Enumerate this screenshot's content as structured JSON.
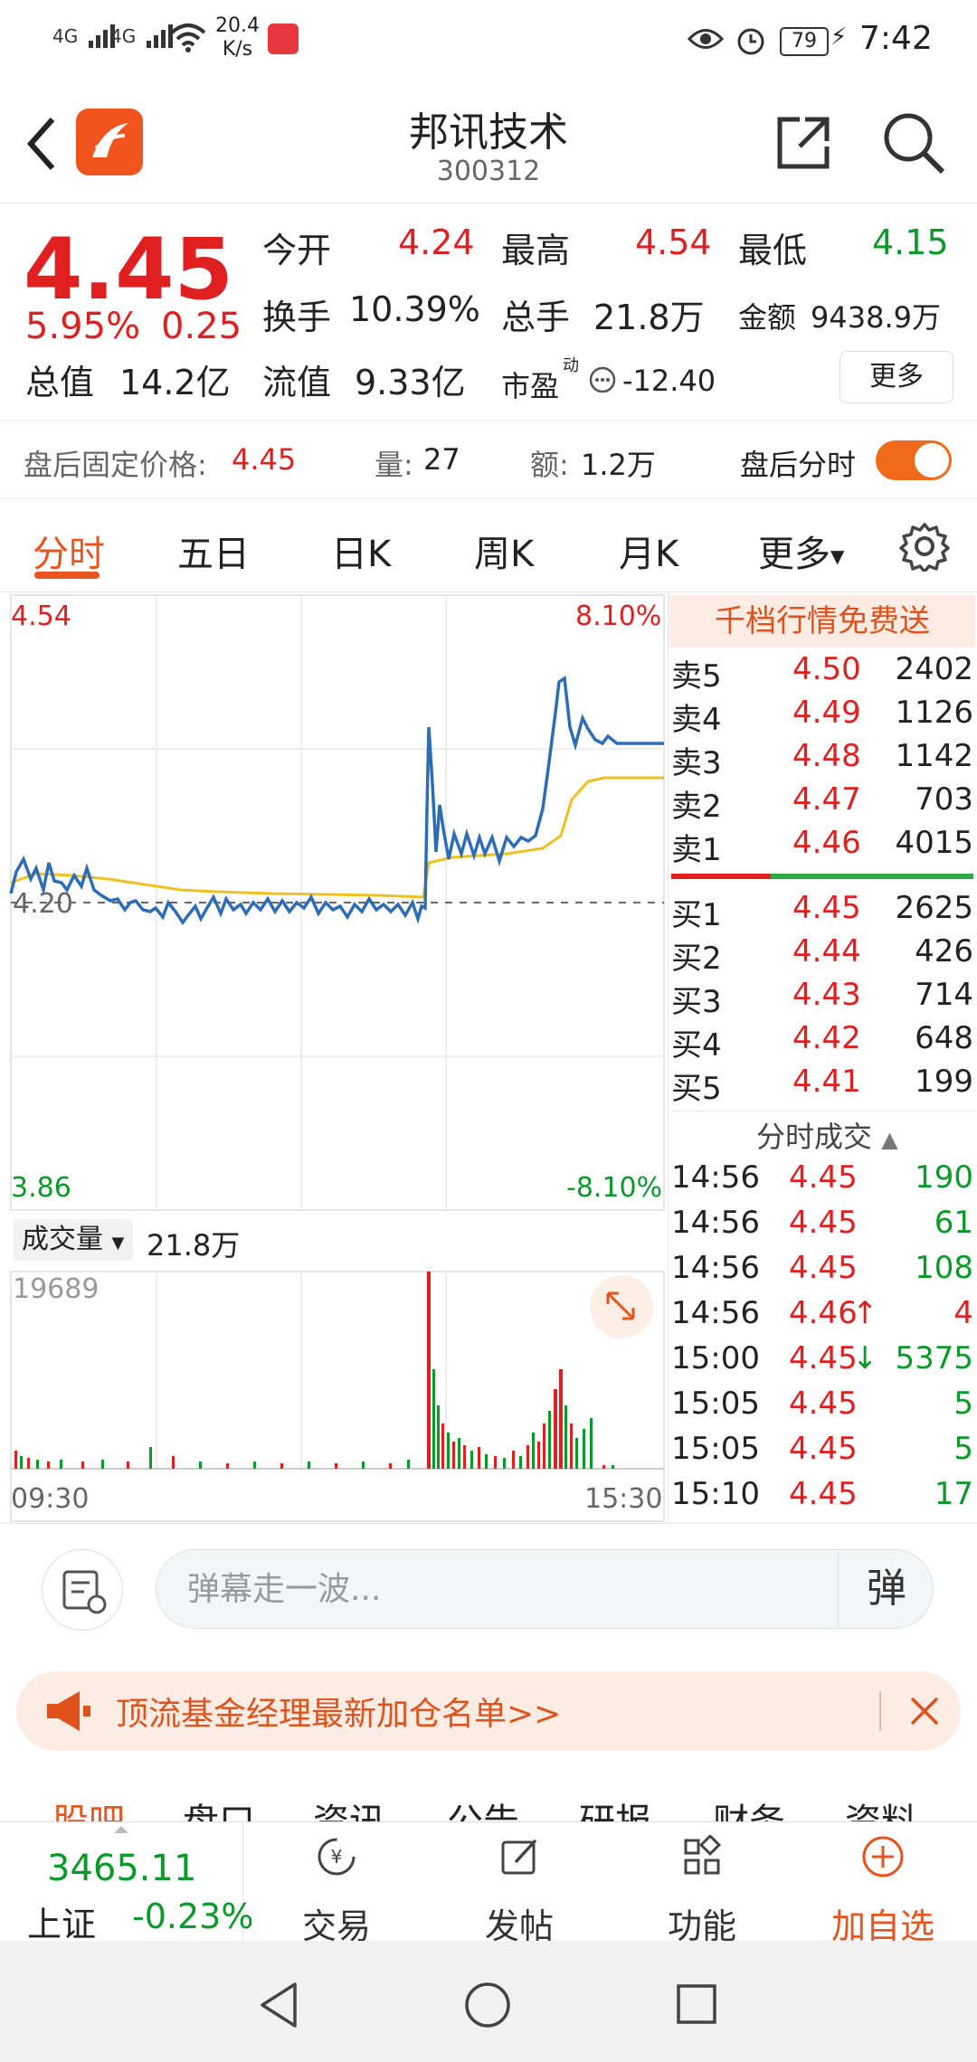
{
  "status": {
    "net1": "4G",
    "net2": "4G",
    "speed_top": "20.4",
    "speed_bottom": "K/s",
    "battery": "79",
    "time": "7:42"
  },
  "header": {
    "title": "邦讯技术",
    "code": "300312"
  },
  "quote": {
    "price": "4.45",
    "pct": "5.95%",
    "change": "0.25",
    "open_label": "今开",
    "open": "4.24",
    "high_label": "最高",
    "high": "4.54",
    "low_label": "最低",
    "low": "4.15",
    "turnover_label": "换手",
    "turnover": "10.39%",
    "volume_label": "总手",
    "volume": "21.8万",
    "amount_label": "金额",
    "amount": "9438.9万",
    "mktcap_label": "总值",
    "mktcap": "14.2亿",
    "float_label": "流值",
    "float": "9.33亿",
    "pe_label": "市盈",
    "pe_sup": "动",
    "pe": "-12.40",
    "more_label": "更多"
  },
  "afterhours": {
    "price_label": "盘后固定价格:",
    "price": "4.45",
    "vol_label": "量:",
    "vol": "27",
    "amt_label": "额:",
    "amt": "1.2万",
    "toggle_label": "盘后分时"
  },
  "tabs": [
    {
      "label": "分时"
    },
    {
      "label": "五日"
    },
    {
      "label": "日K"
    },
    {
      "label": "周K"
    },
    {
      "label": "月K"
    },
    {
      "label": "更多"
    }
  ],
  "chart": {
    "y_high": "4.54",
    "y_mid": "4.20",
    "y_low": "3.86",
    "pct_high": "8.10%",
    "pct_low": "-8.10%",
    "vol_selector": "成交量",
    "vol_total": "21.8万",
    "vol_max": "19689",
    "x_start": "09:30",
    "x_end": "15:30",
    "colors": {
      "price": "#2d6db5",
      "avg": "#f0c020",
      "up": "#e02020",
      "down": "#0a9a2a"
    }
  },
  "orderbook": {
    "banner": "千档行情免费送",
    "asks": [
      {
        "label": "卖5",
        "price": "4.50",
        "vol": "2402"
      },
      {
        "label": "卖4",
        "price": "4.49",
        "vol": "1126"
      },
      {
        "label": "卖3",
        "price": "4.48",
        "vol": "1142"
      },
      {
        "label": "卖2",
        "price": "4.47",
        "vol": "703"
      },
      {
        "label": "卖1",
        "price": "4.46",
        "vol": "4015"
      }
    ],
    "bids": [
      {
        "label": "买1",
        "price": "4.45",
        "vol": "2625"
      },
      {
        "label": "买2",
        "price": "4.44",
        "vol": "426"
      },
      {
        "label": "买3",
        "price": "4.43",
        "vol": "714"
      },
      {
        "label": "买4",
        "price": "4.42",
        "vol": "648"
      },
      {
        "label": "买5",
        "price": "4.41",
        "vol": "199"
      }
    ],
    "ticks_title": "分时成交",
    "ticks": [
      {
        "time": "14:56",
        "price": "4.45",
        "vol": "190",
        "mark": ""
      },
      {
        "time": "14:56",
        "price": "4.45",
        "vol": "61",
        "mark": ""
      },
      {
        "time": "14:56",
        "price": "4.45",
        "vol": "108",
        "mark": ""
      },
      {
        "time": "14:56",
        "price": "4.46",
        "vol": "4",
        "mark": "↑"
      },
      {
        "time": "15:00",
        "price": "4.45",
        "vol": "5375",
        "mark": "↓"
      },
      {
        "time": "15:05",
        "price": "4.45",
        "vol": "5",
        "mark": ""
      },
      {
        "time": "15:05",
        "price": "4.45",
        "vol": "5",
        "mark": ""
      },
      {
        "time": "15:10",
        "price": "4.45",
        "vol": "17",
        "mark": ""
      }
    ]
  },
  "danmu": {
    "placeholder": "弹幕走一波...",
    "btn": "弹"
  },
  "banner": {
    "text": "顶流基金经理最新加仓名单>>"
  },
  "infotabs": [
    "股吧",
    "盘口",
    "资讯",
    "公告",
    "研报",
    "财务",
    "资料"
  ],
  "bottombar": {
    "index_value": "3465.11",
    "index_name": "上证",
    "index_change": "-0.23%",
    "trade": "交易",
    "post": "发帖",
    "func": "功能",
    "watch": "加自选"
  }
}
